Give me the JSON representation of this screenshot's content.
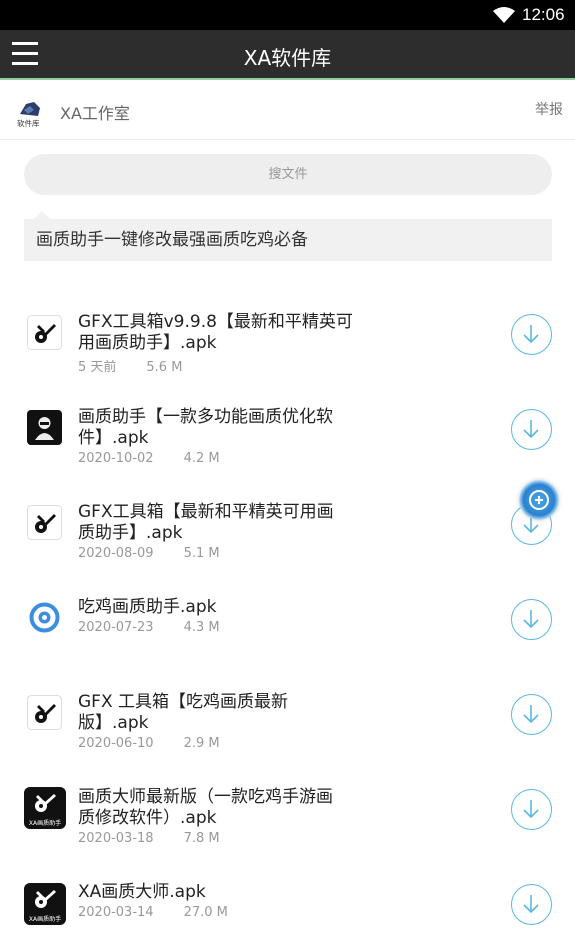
{
  "status": {
    "time": "12:06"
  },
  "header": {
    "title": "XA软件库"
  },
  "studio": {
    "name": "XA工作室",
    "report": "举报",
    "logo_text": "软件库"
  },
  "search": {
    "placeholder": "搜文件"
  },
  "description": "画质助手一键修改最强画质吃鸡必备",
  "files": [
    {
      "name": "GFX工具箱v9.9.8【最新和平精英可用画质助手】.apk",
      "line1": "GFX工具箱v9.9.8【最新和平精英可",
      "line2": "用画质助手】.apk",
      "date": "5 天前",
      "size": "5.6 M",
      "icon": "gear-wrench-icon"
    },
    {
      "name": "画质助手【一款多功能画质优化软件】.apk",
      "line1": "画质助手【一款多功能画质优化软",
      "line2": "件】.apk",
      "date": "2020-10-02",
      "size": "4.2 M",
      "icon": "soldier-icon"
    },
    {
      "name": "GFX工具箱【最新和平精英可用画质助手】.apk",
      "line1": "GFX工具箱【最新和平精英可用画",
      "line2": "质助手】.apk",
      "date": "2020-08-09",
      "size": "5.1 M",
      "icon": "gear-wrench-icon"
    },
    {
      "name": "吃鸡画质助手.apk",
      "line1": "吃鸡画质助手.apk",
      "line2": "",
      "date": "2020-07-23",
      "size": "4.3 M",
      "icon": "blue-circle-icon"
    },
    {
      "name": "GFX 工具箱【吃鸡画质最新版】.apk",
      "line1": "GFX 工具箱【吃鸡画质最新",
      "line2": "版】.apk",
      "date": "2020-06-10",
      "size": "2.9 M",
      "icon": "gear-wrench-icon"
    },
    {
      "name": "画质大师最新版（一款吃鸡手游画质修改软件）.apk",
      "line1": "画质大师最新版（一款吃鸡手游画",
      "line2": "质修改软件）.apk",
      "date": "2020-03-18",
      "size": "7.8 M",
      "icon": "xa-gear-icon",
      "icon_text": "XA画质助手"
    },
    {
      "name": "XA画质大师.apk",
      "line1": "XA画质大师.apk",
      "line2": "",
      "date": "2020-03-14",
      "size": "27.0 M",
      "icon": "xa-gear-icon",
      "icon_text": "XA画质助手"
    }
  ]
}
